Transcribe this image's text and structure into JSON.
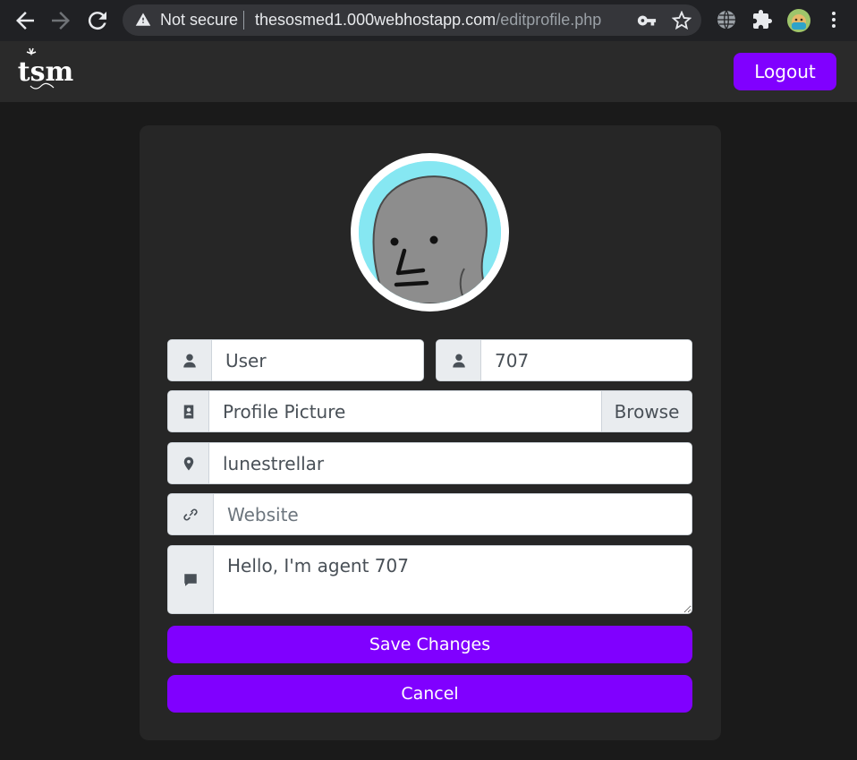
{
  "browser": {
    "back_icon": "back-arrow-icon",
    "forward_icon": "forward-arrow-icon",
    "reload_icon": "reload-icon",
    "security_status": "Not secure",
    "url_host": "thesosmed1.000webhostapp.com",
    "url_path": "/editprofile.php"
  },
  "header": {
    "logo_text": "tsm",
    "logout_label": "Logout"
  },
  "form": {
    "first_name": "User",
    "last_name": "707",
    "picture_placeholder": "Profile Picture",
    "browse_label": "Browse",
    "location": "lunestrellar",
    "website_placeholder": "Website",
    "bio": "Hello, I'm agent 707",
    "save_label": "Save Changes",
    "cancel_label": "Cancel"
  },
  "colors": {
    "accent": "#8000ff",
    "page_bg": "#1a1a1a",
    "card_bg": "#262626"
  }
}
